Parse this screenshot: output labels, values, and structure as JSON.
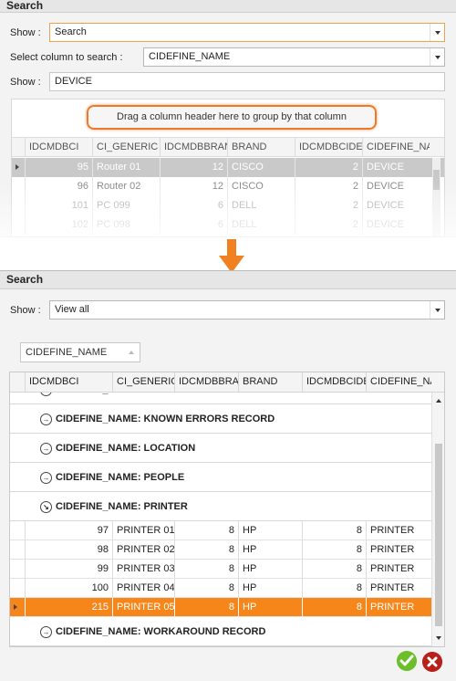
{
  "top": {
    "title": "Search",
    "show_label": "Show :",
    "show_value": "Search",
    "select_col_label": "Select column to search :",
    "select_col_value": "CIDEFINE_NAME",
    "show2_label": "Show :",
    "show2_value": "DEVICE",
    "group_hint": "Drag a column header here to group by that column",
    "columns": [
      "IDCMDBCI",
      "CI_GENERIC",
      "IDCMDBBRAND",
      "BRAND",
      "IDCMDBCIDEFINE",
      "CIDEFINE_NAME"
    ],
    "rows": [
      [
        "95",
        "Router 01",
        "12",
        "CISCO",
        "2",
        "DEVICE"
      ],
      [
        "96",
        "Router 02",
        "12",
        "CISCO",
        "2",
        "DEVICE"
      ],
      [
        "101",
        "PC 099",
        "6",
        "DELL",
        "2",
        "DEVICE"
      ],
      [
        "102",
        "PC 098",
        "6",
        "DELL",
        "2",
        "DEVICE"
      ]
    ]
  },
  "bottom": {
    "title": "Search",
    "show_label": "Show :",
    "show_value": "View all",
    "group_chip": "CIDEFINE_NAME",
    "columns": [
      "IDCMDBCI",
      "CI_GENERIC",
      "IDCMDBBRAND",
      "BRAND",
      "IDCMDBCIDEFINE",
      "CIDEFINE_NAME"
    ],
    "groups": {
      "g0": "CIDEFINE_NAME: DEVICE",
      "g1": "CIDEFINE_NAME: KNOWN ERRORS RECORD",
      "g2": "CIDEFINE_NAME: LOCATION",
      "g3": "CIDEFINE_NAME: PEOPLE",
      "g4": "CIDEFINE_NAME: PRINTER",
      "g5": "CIDEFINE_NAME: WORKAROUND RECORD"
    },
    "printer_rows": [
      [
        "97",
        "PRINTER 01",
        "8",
        "HP",
        "8",
        "PRINTER"
      ],
      [
        "98",
        "PRINTER 02",
        "8",
        "HP",
        "8",
        "PRINTER"
      ],
      [
        "99",
        "PRINTER 03",
        "8",
        "HP",
        "8",
        "PRINTER"
      ],
      [
        "100",
        "PRINTER 04",
        "8",
        "HP",
        "8",
        "PRINTER"
      ],
      [
        "215",
        "PRINTER 05",
        "8",
        "HP",
        "8",
        "PRINTER"
      ]
    ]
  },
  "icons": {
    "arrow": "down-arrow-icon",
    "ok": "check-icon",
    "cancel": "close-icon"
  },
  "colors": {
    "accent": "#f7861a",
    "arrow": "#f08020",
    "ok": "#6bbf2a",
    "cancel": "#b8201a"
  }
}
